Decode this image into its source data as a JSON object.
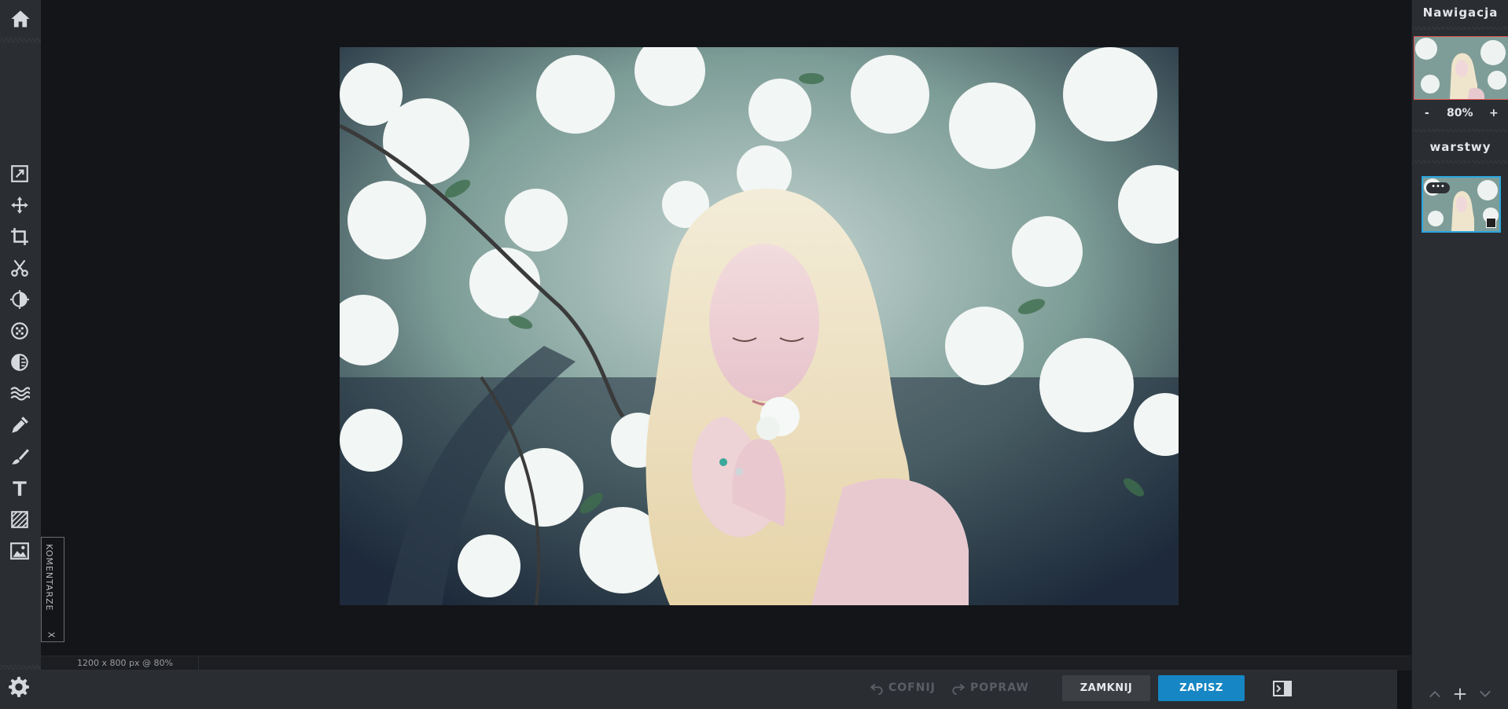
{
  "sidebar": {
    "tools": [
      {
        "name": "adjust-icon"
      },
      {
        "name": "move-icon"
      },
      {
        "name": "crop-icon"
      },
      {
        "name": "cut-icon"
      },
      {
        "name": "brightness-icon"
      },
      {
        "name": "filter-icon"
      },
      {
        "name": "vignette-icon"
      },
      {
        "name": "waves-icon"
      },
      {
        "name": "eyedropper-icon"
      },
      {
        "name": "brush-icon"
      },
      {
        "name": "text-icon"
      },
      {
        "name": "texture-icon"
      },
      {
        "name": "image-icon"
      }
    ]
  },
  "comments": {
    "label": "KOMENTARZE",
    "close": "X"
  },
  "status": {
    "text": "1200 x 800 px @ 80%"
  },
  "history": {
    "undo": "COFNIJ",
    "redo": "POPRAW"
  },
  "actions": {
    "close": "ZAMKNIJ",
    "save": "ZAPISZ"
  },
  "navigation": {
    "title": "Nawigacja",
    "zoom_minus": "-",
    "zoom_value": "80%",
    "zoom_plus": "+"
  },
  "layers": {
    "title": "warstwy",
    "menu": "•••"
  },
  "colors": {
    "accent": "#1686c4",
    "panel": "#2a2d31",
    "canvas": "#141518"
  }
}
